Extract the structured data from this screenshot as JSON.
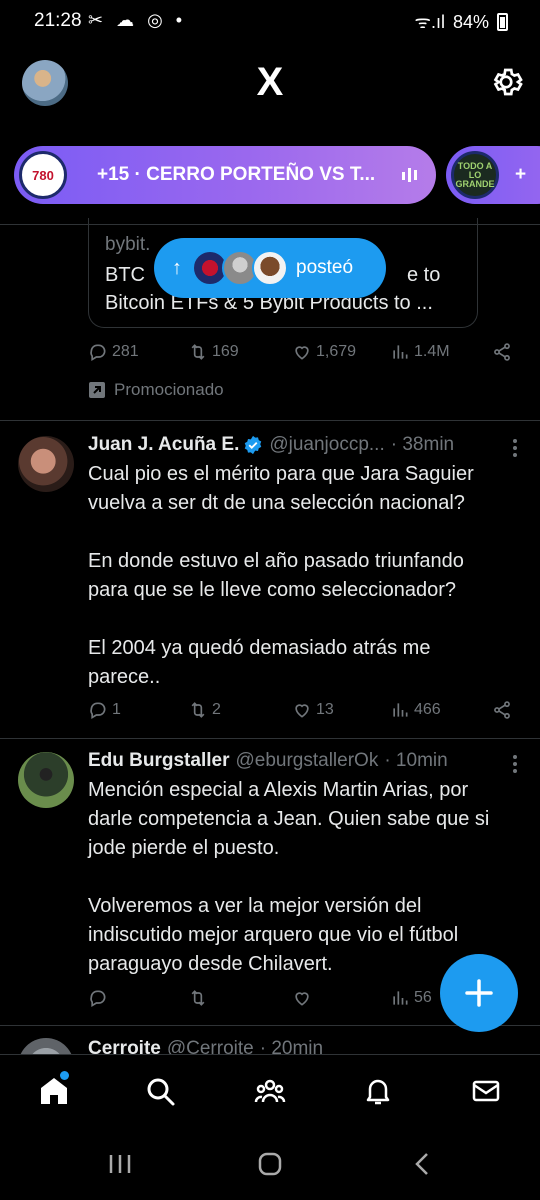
{
  "status_bar": {
    "time": "21:28",
    "notification_icons": "✂ ☁ ◎ •",
    "signal": "ᯤ.ıl",
    "battery": "84%"
  },
  "header": {
    "logo": "X"
  },
  "spaces": {
    "main": {
      "title": "+15 · CERRO PORTEÑO VS T...",
      "logo_text": "780"
    },
    "second": {
      "logo_text": "TODO A LO GRANDE",
      "plus": "+"
    }
  },
  "promo": {
    "domain": "bybit.",
    "line1": "BTC",
    "line1_tail": "e to",
    "line2": "Bitcoin ETFs & 5 Bybit Products to ...",
    "posted_label": "posteó",
    "stats": {
      "replies": "281",
      "reposts": "169",
      "likes": "1,679",
      "views": "1.4M"
    },
    "promoted_label": "Promocionado"
  },
  "tweets": [
    {
      "name": "Juan J. Acuña E.",
      "handle": "@juanjoccp...",
      "time": "· 38min",
      "paragraphs": [
        "Cual pio es el mérito para que Jara Saguier vuelva a ser dt de una selección nacional?",
        "En donde estuvo el año pasado triunfando para que se le lleve como seleccionador?",
        "El 2004 ya quedó demasiado atrás me parece.."
      ],
      "stats": {
        "replies": "1",
        "reposts": "2",
        "likes": "13",
        "views": "466"
      }
    },
    {
      "name": "Edu Burgstaller",
      "handle": "@eburgstallerOk",
      "time": "· 10min",
      "paragraphs": [
        "Mención especial a Alexis Martin Arias, por darle competencia a Jean. Quien sabe que si jode pierde el puesto.",
        "Volveremos a ver la mejor versión del indiscutido mejor arquero que vio el fútbol paraguayo desde Chilavert."
      ],
      "stats": {
        "views": "56"
      }
    },
    {
      "name": "Cerroite",
      "handle": "@Cerroite",
      "time": "· 20min"
    }
  ],
  "colors": {
    "accent": "#1d9bf0",
    "space_gradient_start": "#7b5cf5",
    "space_gradient_end": "#b57ce9",
    "muted": "#71767b",
    "divider": "#2f3336"
  }
}
